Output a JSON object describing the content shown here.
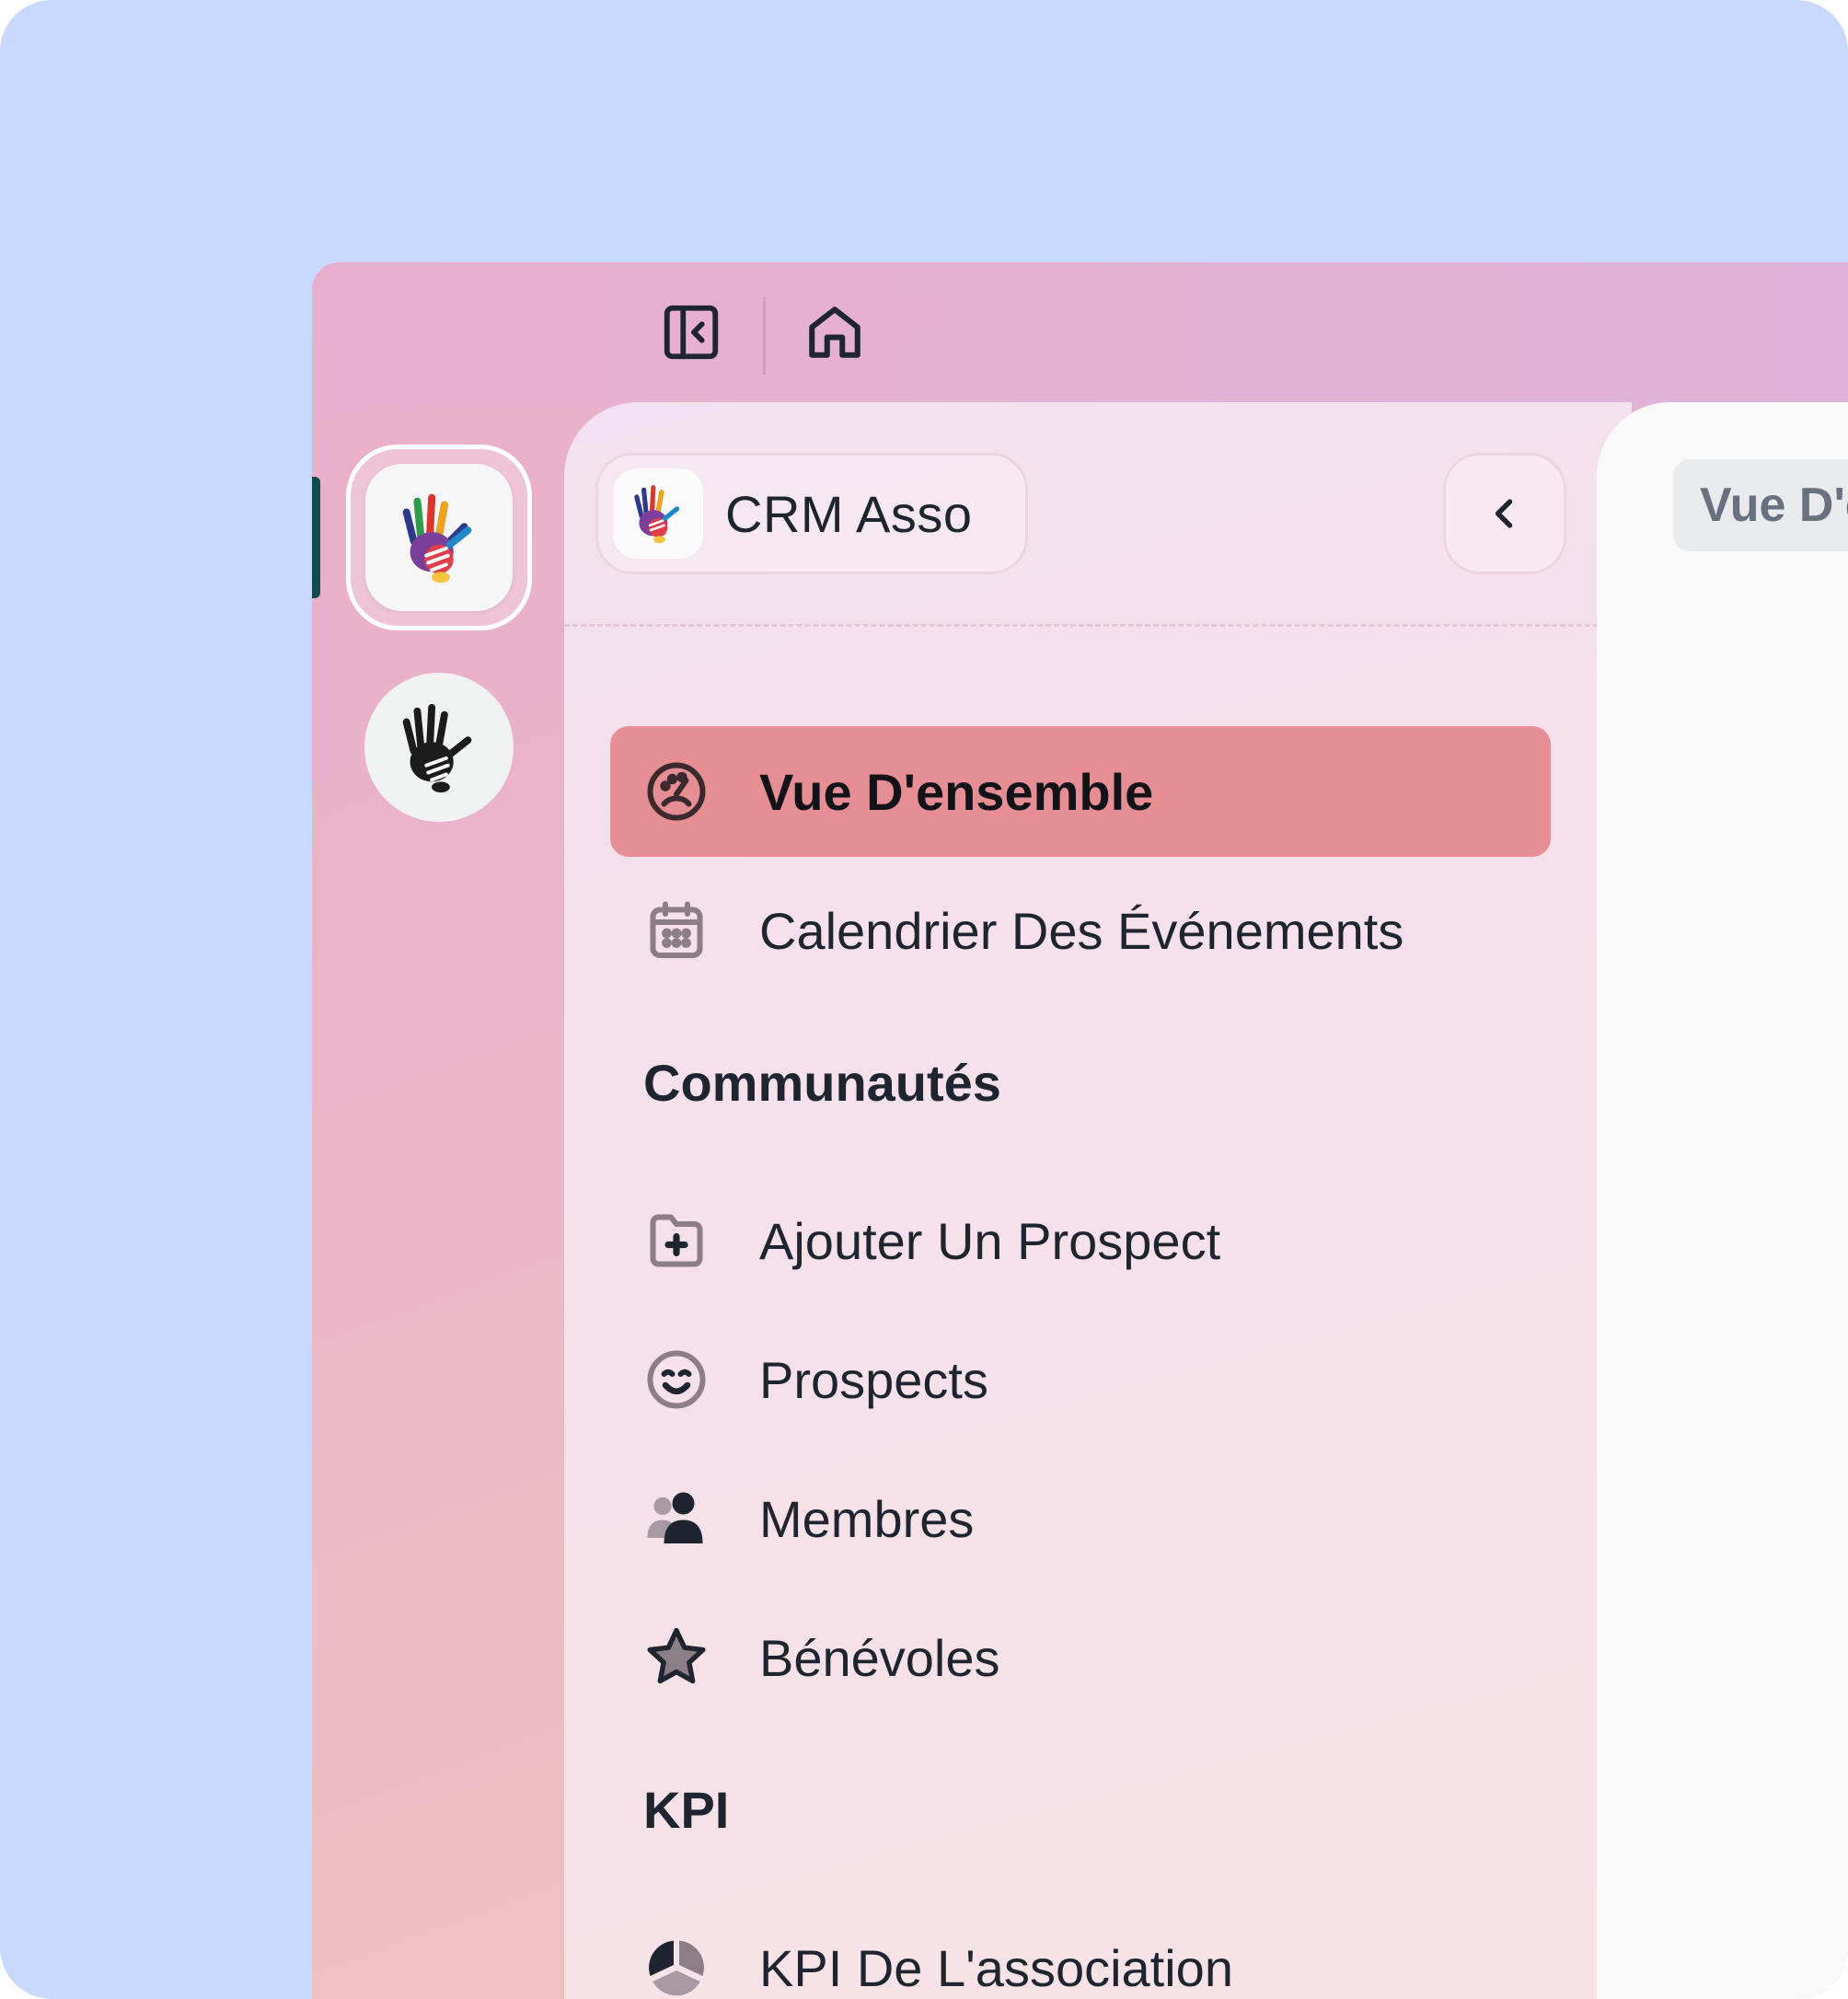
{
  "app": {
    "org_name": "CRM Asso",
    "content_title": "Vue D'ensemble"
  },
  "toolbar": {
    "sidebar_toggle_icon": "sidebar-collapse-icon",
    "home_icon": "home-icon"
  },
  "workspaces": [
    {
      "icon": "colorful-hands-logo",
      "active": true
    },
    {
      "icon": "black-white-hands-logo",
      "active": false
    }
  ],
  "nav": {
    "items_top": [
      {
        "label": "Vue D'ensemble",
        "icon": "dashboard-gauge-icon",
        "active": true
      },
      {
        "label": "Calendrier Des Événements",
        "icon": "calendar-icon",
        "active": false
      }
    ],
    "sections": [
      {
        "title": "Communautés",
        "items": [
          {
            "label": "Ajouter Un Prospect",
            "icon": "folder-plus-icon"
          },
          {
            "label": "Prospects",
            "icon": "smiley-icon"
          },
          {
            "label": "Membres",
            "icon": "users-icon"
          },
          {
            "label": "Bénévoles",
            "icon": "star-icon"
          }
        ]
      },
      {
        "title": "KPI",
        "items": [
          {
            "label": "KPI De L'association",
            "icon": "pie-chart-icon"
          }
        ]
      }
    ]
  },
  "colors": {
    "background": "#c8d9fd",
    "active_item": "#e78e94",
    "text": "#1f2530"
  }
}
